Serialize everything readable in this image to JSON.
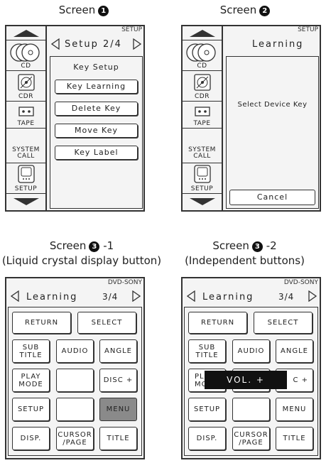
{
  "captions": {
    "screen1": "Screen",
    "screen1_num": "1",
    "screen2": "Screen",
    "screen2_num": "2",
    "screen3a": "Screen",
    "screen3a_num": "3",
    "screen3a_suffix": "-1",
    "screen3a_sub": "(Liquid crystal display button)",
    "screen3b": "Screen",
    "screen3b_num": "3",
    "screen3b_suffix": "-2",
    "screen3b_sub": "(Independent buttons)"
  },
  "sidebar": {
    "items": [
      {
        "label": "CD",
        "icon": "cd-icon"
      },
      {
        "label": "CDR",
        "icon": "cdr-icon"
      },
      {
        "label": "TAPE",
        "icon": "tape-icon"
      },
      {
        "label": "SYSTEM CALL",
        "line1": "SYSTEM",
        "line2": "CALL"
      },
      {
        "label": "SETUP",
        "icon": "remote-icon"
      }
    ]
  },
  "screen1": {
    "mode": "SETUP",
    "header": "Setup 2/4",
    "title": "Key Setup",
    "items": [
      "Key Learning",
      "Delete Key",
      "Move Key",
      "Key Label"
    ]
  },
  "screen2": {
    "mode": "SETUP",
    "header": "Learning",
    "message": "Select Device Key",
    "cancel": "Cancel"
  },
  "screen3a": {
    "device": "DVD-SONY",
    "header": "Learning",
    "page": "3/4",
    "buttons": {
      "return": "RETURN",
      "select": "SELECT",
      "subtitle1": "SUB",
      "subtitle2": "TITLE",
      "audio": "AUDIO",
      "angle": "ANGLE",
      "playmode1": "PLAY",
      "playmode2": "MODE",
      "disc": "DISC +",
      "setup": "SETUP",
      "menu": "MENU",
      "disp": "DISP.",
      "cursor1": "CURSOR",
      "cursor2": "/PAGE",
      "title": "TITLE"
    }
  },
  "screen3b": {
    "device": "DVD-SONY",
    "header": "Learning",
    "page": "3/4",
    "overlay": "VOL. +",
    "buttons": {
      "return": "RETURN",
      "select": "SELECT",
      "subtitle1": "SUB",
      "subtitle2": "TITLE",
      "audio": "AUDIO",
      "angle": "ANGLE",
      "playmode_partial1": "PL",
      "playmode_partial2": "MO",
      "disc_partial": "C +",
      "setup": "SETUP",
      "menu": "MENU",
      "disp": "DISP.",
      "cursor1": "CURSOR",
      "cursor2": "/PAGE",
      "title": "TITLE"
    }
  }
}
